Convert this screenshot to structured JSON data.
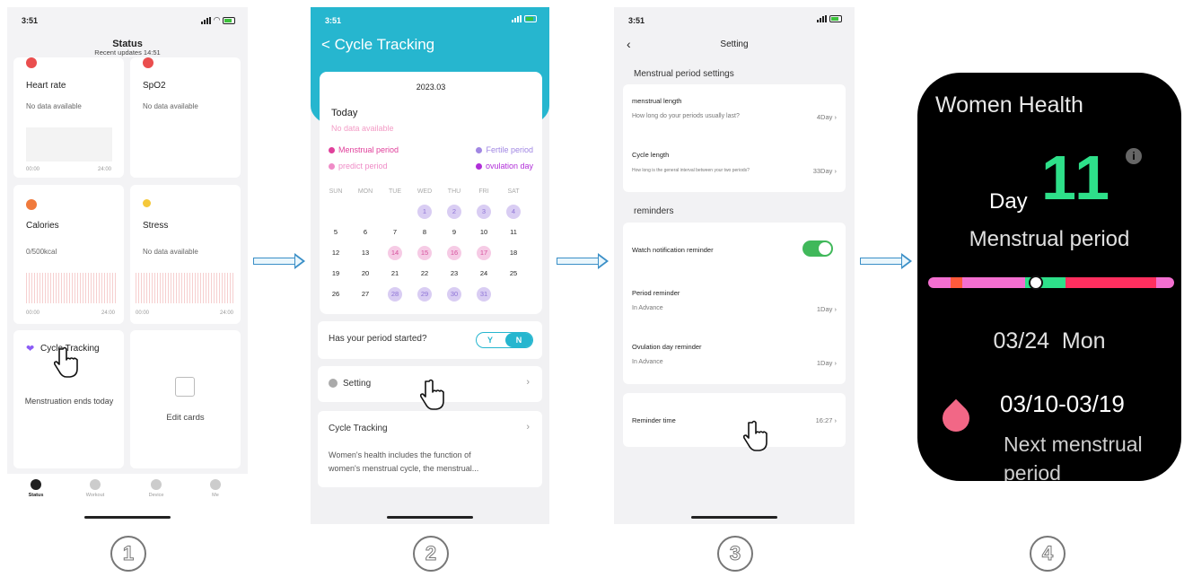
{
  "phone_status": {
    "time": "3:51",
    "wifi": "◠",
    "arrow": "↗"
  },
  "screen1": {
    "title": "Status",
    "subtitle": "Recent updates 14:51",
    "heart_rate": {
      "title": "Heart rate",
      "sub": "No data available",
      "axis_start": "00:00",
      "axis_end": "24:00"
    },
    "spo2": {
      "title": "SpO2",
      "sub": "No data available"
    },
    "calories": {
      "title": "Calories",
      "sub": "0/500kcal",
      "axis_start": "00:00",
      "axis_end": "24:00"
    },
    "stress": {
      "title": "Stress",
      "sub": "No data available",
      "axis_start": "00:00",
      "axis_end": "24:00"
    },
    "cycle": {
      "title": "Cycle Tracking",
      "sub": "Menstruation ends today"
    },
    "edit_cards": "Edit cards",
    "tabs": [
      "Status",
      "Workout",
      "Device",
      "Me"
    ]
  },
  "screen2": {
    "header_title": "< Cycle Tracking",
    "month": "2023.03",
    "today_label": "Today",
    "today_sub": "No data available",
    "legend": {
      "menstrual": "Menstrual period",
      "fertile": "Fertile period",
      "predict": "predict period",
      "ovulation": "ovulation day"
    },
    "colors": {
      "accent": "#26b6cf",
      "menstrual": "#e0409b",
      "fertile": "#a187e3",
      "predict": "#ef8cc7",
      "ovulation": "#b02ed8"
    },
    "weekdays": [
      "SUN",
      "MON",
      "TUE",
      "WED",
      "THU",
      "FRI",
      "SAT"
    ],
    "weeks": [
      [
        "",
        "",
        "",
        "1",
        "2",
        "3",
        "4"
      ],
      [
        "5",
        "6",
        "7",
        "8",
        "9",
        "10",
        "11"
      ],
      [
        "12",
        "13",
        "14",
        "15",
        "16",
        "17",
        "18"
      ],
      [
        "19",
        "20",
        "21",
        "22",
        "23",
        "24",
        "25"
      ],
      [
        "26",
        "27",
        "28",
        "29",
        "30",
        "31",
        ""
      ]
    ],
    "question": "Has your period started?",
    "yes": "Y",
    "no": "N",
    "setting": "Setting",
    "info_title": "Cycle Tracking",
    "info_text_1": "Women's health includes the function of",
    "info_text_2": "women's menstrual cycle, the menstrual..."
  },
  "screen3": {
    "title": "Setting",
    "section_period": "Menstrual period settings",
    "menstrual_length": {
      "title": "menstrual length",
      "sub": "How long do your periods usually last?",
      "value": "4Day"
    },
    "cycle_length": {
      "title": "Cycle length",
      "sub": "How long is the general interval between your two periods?",
      "value": "33Day"
    },
    "section_reminders": "reminders",
    "watch_notification": "Watch notification reminder",
    "period_reminder": {
      "title": "Period reminder",
      "sub": "In Advance",
      "value": "1Day"
    },
    "ovulation_reminder": {
      "title": "Ovulation day reminder",
      "sub": "In Advance",
      "value": "1Day"
    },
    "reminder_time": {
      "title": "Reminder time",
      "value": "16:27"
    }
  },
  "watch": {
    "title": "Women Health",
    "info": "i",
    "day_label": "Day",
    "day_number": "11",
    "phase": "Menstrual period",
    "date": "03/24  Mon",
    "range": "03/10-03/19",
    "next_label": "Next menstrual period",
    "bar_colors": [
      "#f36fd0",
      "#ff5a3c",
      "#f36fd0",
      "#2ee08a",
      "#ff2f5f",
      "#f36fd0"
    ],
    "bar_flex": [
      10,
      5,
      28,
      18,
      40,
      8
    ]
  },
  "steps": [
    "1",
    "2",
    "3",
    "4"
  ]
}
